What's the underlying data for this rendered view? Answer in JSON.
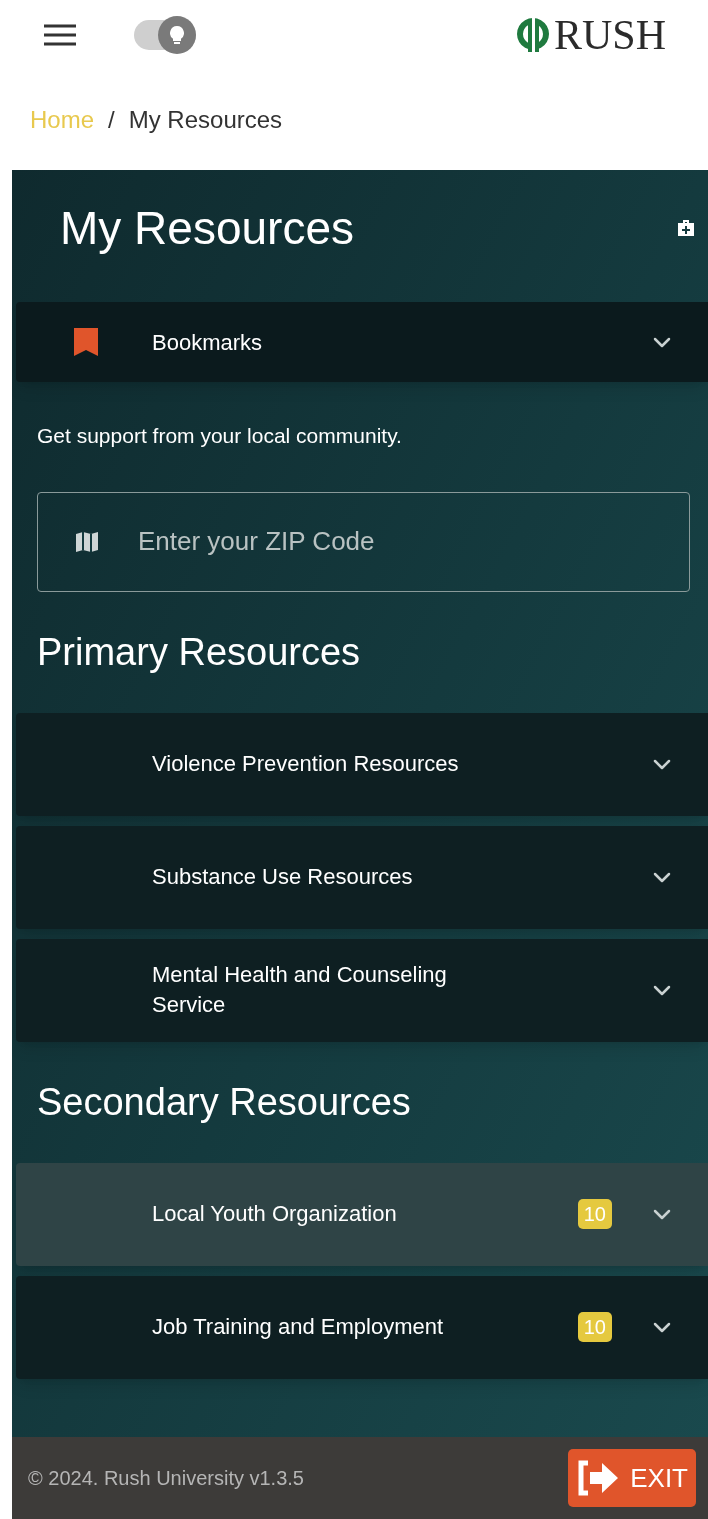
{
  "header": {
    "theme_toggle": {
      "on": false
    },
    "logo": "RUSH"
  },
  "breadcrumb": [
    {
      "label": "Home",
      "link": true
    },
    {
      "label": "/",
      "link": false
    },
    {
      "label": "My Resources",
      "link": false
    }
  ],
  "panel": {
    "title": "My Resources",
    "bookmarks": {
      "label": "Bookmarks",
      "expanded": false
    },
    "intro": "Get support from your local community.",
    "zip": {
      "placeholder": "Enter your ZIP Code"
    },
    "sections": [
      {
        "heading": "Primary Resources",
        "items": [
          {
            "label": "Violence Prevention Resources",
            "selected": false,
            "expanded": false
          },
          {
            "label": "Substance Use Resources",
            "selected": false,
            "expanded": false
          },
          {
            "label": "Mental Health and Counseling Service",
            "selected": false,
            "expanded": false
          }
        ]
      },
      {
        "heading": "Secondary Resources",
        "items": [
          {
            "label": "Local Youth Organization",
            "count": "10",
            "selected": true,
            "expanded": false
          },
          {
            "label": "Job Training and Employment",
            "count": "10",
            "selected": false,
            "expanded": false
          }
        ]
      }
    ]
  },
  "footer": {
    "copyright": "© 2024. Rush University v1.3.5",
    "exit": "EXIT"
  }
}
